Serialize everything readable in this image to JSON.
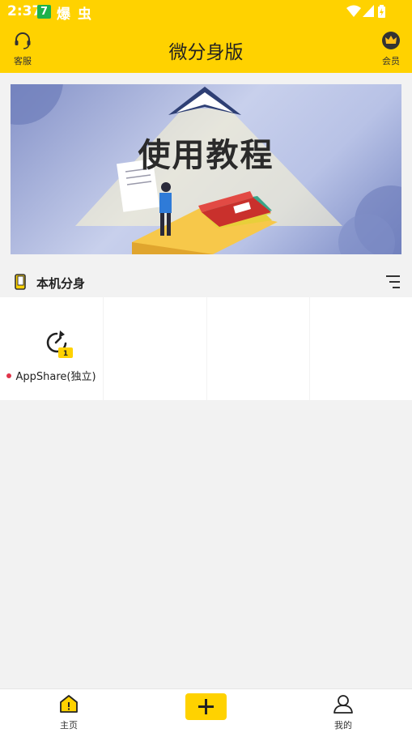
{
  "status_bar": {
    "time": "2:37",
    "badge": "7",
    "app1": "爆",
    "app2": "虫"
  },
  "header": {
    "title": "微分身版",
    "left_label": "客服",
    "right_label": "会员"
  },
  "banner": {
    "title": "使用教程"
  },
  "section": {
    "title": "本机分身"
  },
  "apps": [
    {
      "label": "AppShare(独立)",
      "badge": "1"
    }
  ],
  "bottom_nav": {
    "home_label": "主页",
    "me_label": "我的"
  },
  "colors": {
    "accent": "#ffd200",
    "background": "#f2f2f2",
    "status_dot": "#e0344a"
  }
}
